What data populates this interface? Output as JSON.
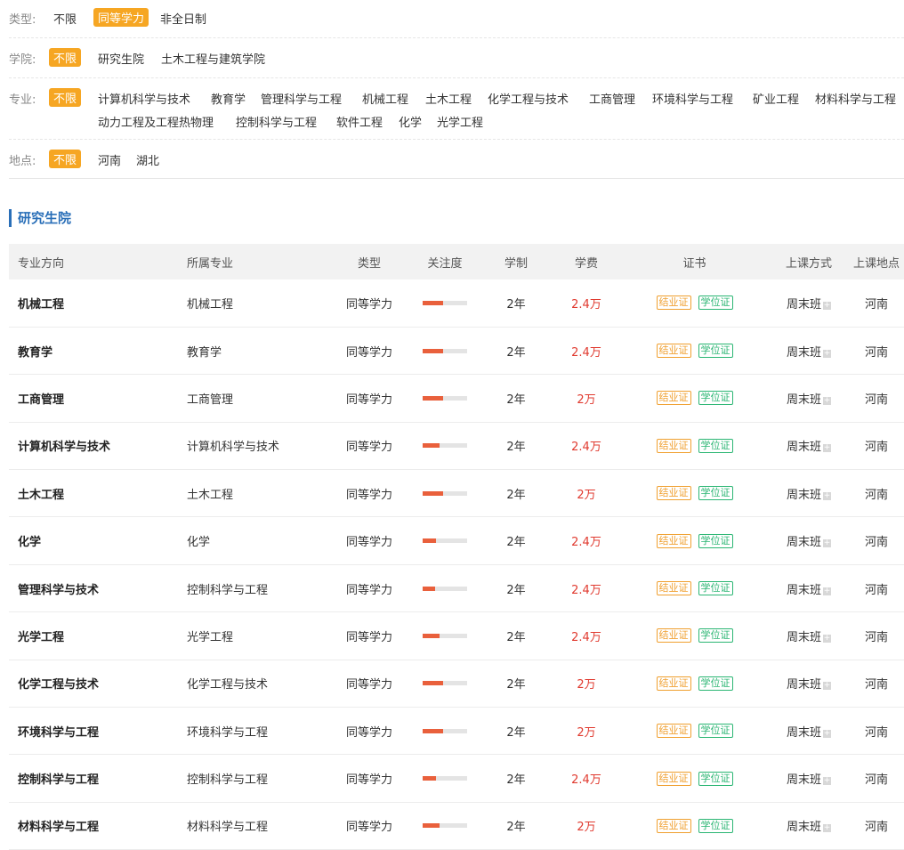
{
  "filters": {
    "type": {
      "label": "类型:",
      "options": [
        "不限",
        "同等学力",
        "非全日制"
      ]
    },
    "school": {
      "label": "学院:",
      "options": [
        "不限",
        "研究生院",
        "土木工程与建筑学院"
      ]
    },
    "major": {
      "label": "专业:",
      "options": [
        "不限",
        "计算机科学与技术",
        "教育学",
        "管理科学与工程",
        "机械工程",
        "土木工程",
        "化学工程与技术",
        "工商管理",
        "环境科学与工程",
        "矿业工程",
        "材料科学与工程",
        "动力工程及工程热物理",
        "控制科学与工程",
        "软件工程",
        "化学",
        "光学工程"
      ]
    },
    "location": {
      "label": "地点:",
      "options": [
        "不限",
        "河南",
        "湖北"
      ]
    }
  },
  "section_title": "研究生院",
  "table": {
    "headers": [
      "专业方向",
      "所属专业",
      "类型",
      "关注度",
      "学制",
      "学费",
      "证书",
      "上课方式",
      "上课地点"
    ],
    "cert_label": "结业证",
    "degree_label": "学位证",
    "rows": [
      {
        "direction": "机械工程",
        "major": "机械工程",
        "type": "同等学力",
        "attention": 0.45,
        "duration": "2年",
        "fee": "2.4万",
        "mode": "周末班",
        "place": "河南"
      },
      {
        "direction": "教育学",
        "major": "教育学",
        "type": "同等学力",
        "attention": 0.45,
        "duration": "2年",
        "fee": "2.4万",
        "mode": "周末班",
        "place": "河南"
      },
      {
        "direction": "工商管理",
        "major": "工商管理",
        "type": "同等学力",
        "attention": 0.45,
        "duration": "2年",
        "fee": "2万",
        "mode": "周末班",
        "place": "河南"
      },
      {
        "direction": "计算机科学与技术",
        "major": "计算机科学与技术",
        "type": "同等学力",
        "attention": 0.38,
        "duration": "2年",
        "fee": "2.4万",
        "mode": "周末班",
        "place": "河南"
      },
      {
        "direction": "土木工程",
        "major": "土木工程",
        "type": "同等学力",
        "attention": 0.45,
        "duration": "2年",
        "fee": "2万",
        "mode": "周末班",
        "place": "河南"
      },
      {
        "direction": "化学",
        "major": "化学",
        "type": "同等学力",
        "attention": 0.3,
        "duration": "2年",
        "fee": "2.4万",
        "mode": "周末班",
        "place": "河南"
      },
      {
        "direction": "管理科学与技术",
        "major": "控制科学与工程",
        "type": "同等学力",
        "attention": 0.28,
        "duration": "2年",
        "fee": "2.4万",
        "mode": "周末班",
        "place": "河南"
      },
      {
        "direction": "光学工程",
        "major": "光学工程",
        "type": "同等学力",
        "attention": 0.38,
        "duration": "2年",
        "fee": "2.4万",
        "mode": "周末班",
        "place": "河南"
      },
      {
        "direction": "化学工程与技术",
        "major": "化学工程与技术",
        "type": "同等学力",
        "attention": 0.45,
        "duration": "2年",
        "fee": "2万",
        "mode": "周末班",
        "place": "河南"
      },
      {
        "direction": "环境科学与工程",
        "major": "环境科学与工程",
        "type": "同等学力",
        "attention": 0.45,
        "duration": "2年",
        "fee": "2万",
        "mode": "周末班",
        "place": "河南"
      },
      {
        "direction": "控制科学与工程",
        "major": "控制科学与工程",
        "type": "同等学力",
        "attention": 0.3,
        "duration": "2年",
        "fee": "2.4万",
        "mode": "周末班",
        "place": "河南"
      },
      {
        "direction": "材料科学与工程",
        "major": "材料科学与工程",
        "type": "同等学力",
        "attention": 0.38,
        "duration": "2年",
        "fee": "2万",
        "mode": "周末班",
        "place": "河南"
      }
    ]
  },
  "colors": {
    "accent": "#f6a623",
    "title_blue": "#2a6fb8",
    "fee_red": "#e03a2f",
    "bar": "#e9603c",
    "cert": "#f0a030",
    "degree": "#2bb673"
  }
}
